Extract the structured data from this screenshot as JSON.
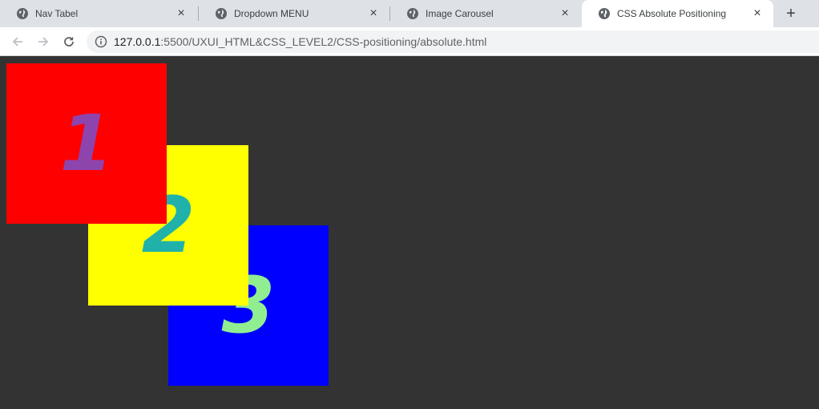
{
  "tabs": [
    {
      "label": "Nav Tabel",
      "active": false,
      "icon": "globe-icon"
    },
    {
      "label": "Dropdown MENU",
      "active": false,
      "icon": "globe-icon"
    },
    {
      "label": "Image Carousel",
      "active": false,
      "icon": "globe-icon"
    },
    {
      "label": "CSS Absolute Positioning",
      "active": true,
      "icon": "globe-icon"
    }
  ],
  "toolbar": {
    "url_host": "127.0.0.1",
    "url_rest": ":5500/UXUI_HTML&CSS_LEVEL2/CSS-positioning/absolute.html"
  },
  "boxes": [
    {
      "label": "1",
      "background": "#ff0000",
      "text_color": "#8e44ad"
    },
    {
      "label": "2",
      "background": "#ffff00",
      "text_color": "#20b2aa"
    },
    {
      "label": "3",
      "background": "#0000ff",
      "text_color": "#90ee90"
    }
  ],
  "colors": {
    "page_background": "#333333",
    "tabstrip_background": "#dee1e6"
  }
}
